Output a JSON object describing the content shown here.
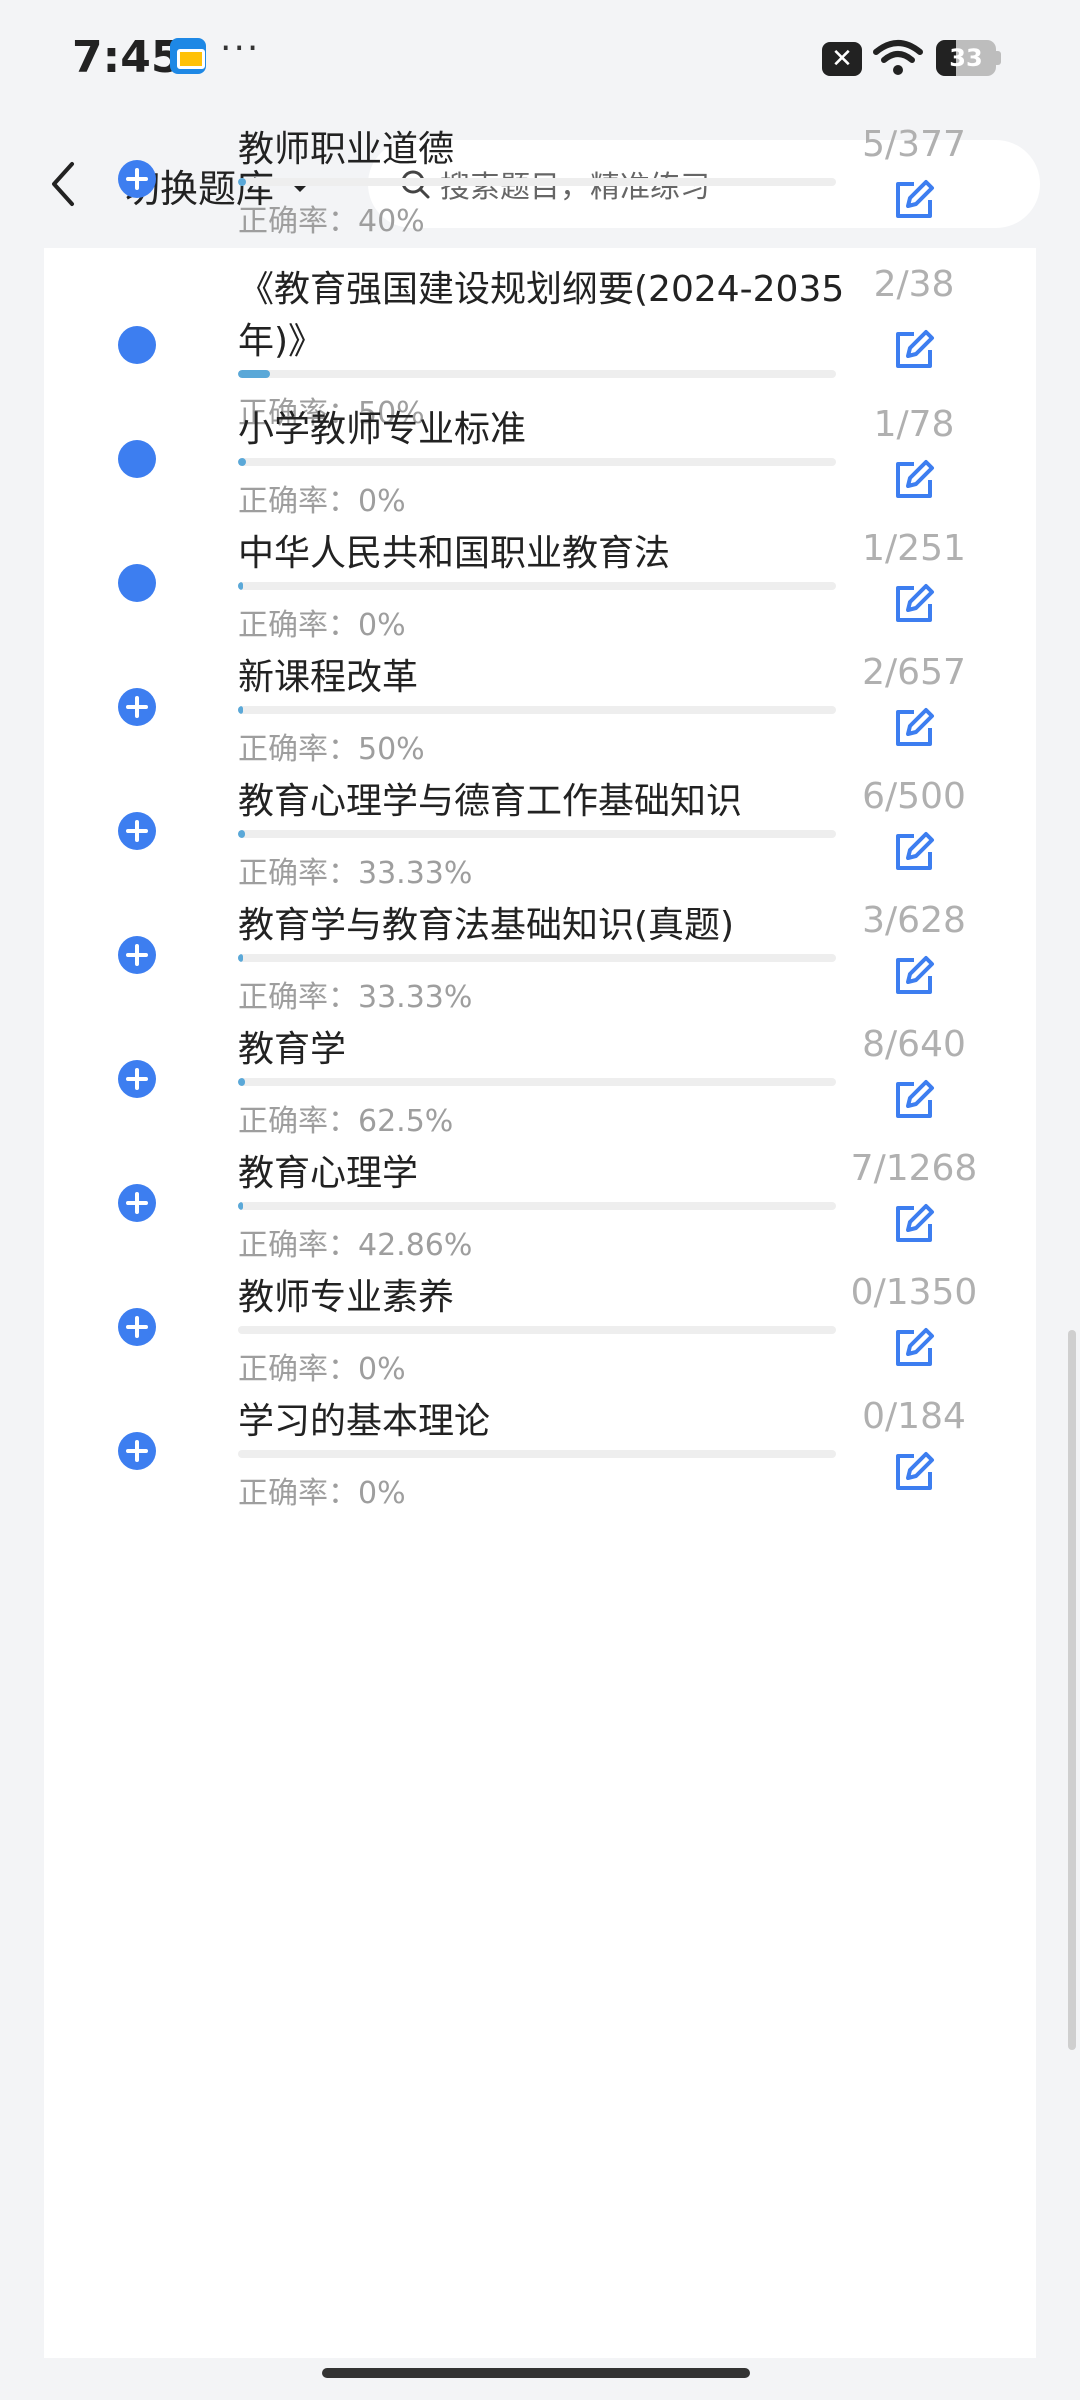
{
  "status_bar": {
    "time": "7:45",
    "more": "···",
    "sim_label": "✕",
    "battery": "33",
    "battery_level_percent": 33
  },
  "header": {
    "title": "切换题库",
    "search_placeholder": "搜索题目，精准练习"
  },
  "accent_color": "#3d7ef0",
  "items": [
    {
      "title": "教师职业道德",
      "accuracy": "正确率：40%",
      "count": "5/377",
      "icon": "plus-circle-icon",
      "progress_fraction": 0.013
    },
    {
      "title": "《教育强国建设规划纲要(2024-2035年)》",
      "accuracy": "正确率：50%",
      "count": "2/38",
      "icon": "dot-icon",
      "progress_fraction": 0.053
    },
    {
      "title": "小学教师专业标准",
      "accuracy": "正确率：0%",
      "count": "1/78",
      "icon": "dot-icon",
      "progress_fraction": 0.013
    },
    {
      "title": "中华人民共和国职业教育法",
      "accuracy": "正确率：0%",
      "count": "1/251",
      "icon": "dot-icon",
      "progress_fraction": 0.004
    },
    {
      "title": "新课程改革",
      "accuracy": "正确率：50%",
      "count": "2/657",
      "icon": "plus-circle-icon",
      "progress_fraction": 0.003
    },
    {
      "title": "教育心理学与德育工作基础知识",
      "accuracy": "正确率：33.33%",
      "count": "6/500",
      "icon": "plus-circle-icon",
      "progress_fraction": 0.012
    },
    {
      "title": "教育学与教育法基础知识(真题)",
      "accuracy": "正确率：33.33%",
      "count": "3/628",
      "icon": "plus-circle-icon",
      "progress_fraction": 0.005
    },
    {
      "title": "教育学",
      "accuracy": "正确率：62.5%",
      "count": "8/640",
      "icon": "plus-circle-icon",
      "progress_fraction": 0.0125
    },
    {
      "title": "教育心理学",
      "accuracy": "正确率：42.86%",
      "count": "7/1268",
      "icon": "plus-circle-icon",
      "progress_fraction": 0.0055
    },
    {
      "title": "教师专业素养",
      "accuracy": "正确率：0%",
      "count": "0/1350",
      "icon": "plus-circle-icon",
      "progress_fraction": 0
    },
    {
      "title": "学习的基本理论",
      "accuracy": "正确率：0%",
      "count": "0/184",
      "icon": "plus-circle-icon",
      "progress_fraction": 0
    }
  ]
}
